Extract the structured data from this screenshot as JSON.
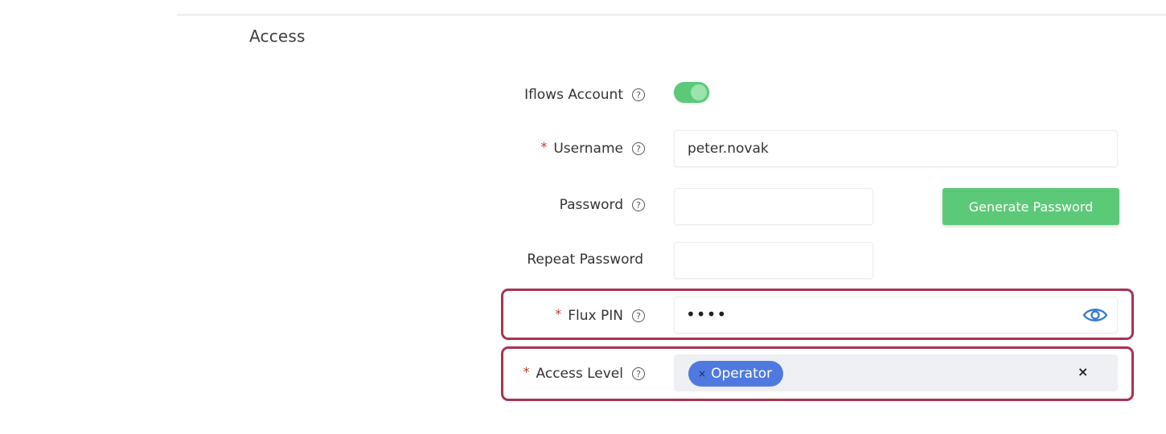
{
  "section": {
    "title": "Access"
  },
  "form": {
    "iflows_account": {
      "label": "Iflows Account",
      "enabled": true,
      "help_icon": "question-circle-icon"
    },
    "username": {
      "label": "Username",
      "required_mark": "*",
      "value": "peter.novak",
      "help_icon": "question-circle-icon"
    },
    "password": {
      "label": "Password",
      "value": "",
      "help_icon": "question-circle-icon",
      "generate_button_label": "Generate Password"
    },
    "repeat_password": {
      "label": "Repeat Password",
      "value": ""
    },
    "flux_pin": {
      "label": "Flux PIN",
      "required_mark": "*",
      "masked_value": "••••",
      "help_icon": "question-circle-icon",
      "toggle_icon": "eye-icon"
    },
    "access_level": {
      "label": "Access Level",
      "required_mark": "*",
      "help_icon": "question-circle-icon",
      "selected": [
        "Operator"
      ],
      "chip_remove_glyph": "×",
      "clear_glyph": "×"
    },
    "help_glyph": "?"
  },
  "colors": {
    "accent_green": "#5cc978",
    "chip_blue": "#4f79df",
    "required_red": "#c0392b",
    "highlight_border": "#a83250",
    "eye_blue": "#3a7bd5"
  }
}
